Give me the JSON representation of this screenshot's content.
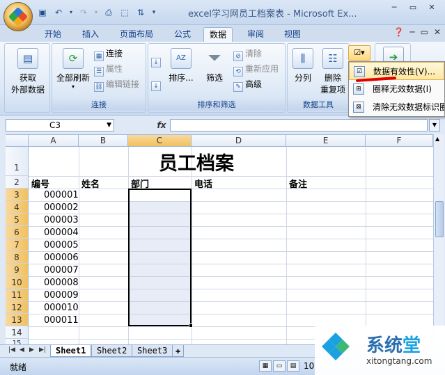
{
  "app": {
    "title": "excel学习网员工档案表 - Microsoft Ex...",
    "window_buttons": [
      "─",
      "▭",
      "✕"
    ]
  },
  "qat": {
    "save_icon": "save-icon",
    "undo_icon": "undo-icon",
    "redo_icon": "redo-icon"
  },
  "tabs": [
    {
      "label": "开始"
    },
    {
      "label": "插入"
    },
    {
      "label": "页面布局"
    },
    {
      "label": "公式"
    },
    {
      "label": "数据",
      "active": true
    },
    {
      "label": "审阅"
    },
    {
      "label": "视图"
    }
  ],
  "ribbon": {
    "groups": {
      "external": {
        "button": "获取\n外部数据",
        "line1": "获取",
        "line2": "外部数据"
      },
      "connections": {
        "label": "连接",
        "refresh_all": "全部刷新",
        "connections": "连接",
        "properties": "属性",
        "edit_links": "编辑链接"
      },
      "sort_filter": {
        "label": "排序和筛选",
        "sort": "排序...",
        "filter": "筛选",
        "clear": "清除",
        "reapply": "重新应用",
        "advanced": "高级"
      },
      "data_tools": {
        "label": "数据工具",
        "text_to_columns": "分列",
        "remove_dup_1": "删除",
        "remove_dup_2": "重复项"
      }
    }
  },
  "menu": {
    "items": [
      {
        "label": "数据有效性(V)...",
        "highlighted": true
      },
      {
        "label": "圈释无效数据(I)"
      },
      {
        "label": "清除无效数据标识圈"
      }
    ]
  },
  "formula_bar": {
    "name_box": "C3",
    "fx": "fx",
    "formula": ""
  },
  "sheet": {
    "columns": [
      "A",
      "B",
      "C",
      "D",
      "E",
      "F"
    ],
    "rows": [
      "1",
      "2",
      "3",
      "4",
      "5",
      "6",
      "7",
      "8",
      "9",
      "10",
      "11",
      "12",
      "13",
      "14",
      "15"
    ],
    "title": "员工档案",
    "headers": {
      "a": "编号",
      "b": "姓名",
      "c": "部门",
      "d": "电话",
      "e": "备注"
    },
    "ids": [
      "000001",
      "000002",
      "000003",
      "000004",
      "000005",
      "000006",
      "000007",
      "000008",
      "000009",
      "000010",
      "000011"
    ]
  },
  "sheet_tabs": [
    {
      "label": "Sheet1",
      "active": true
    },
    {
      "label": "Sheet2"
    },
    {
      "label": "Sheet3"
    }
  ],
  "status": {
    "ready": "就绪",
    "zoom": "10"
  },
  "watermark": {
    "name_1": "系统",
    "name_2": "堂",
    "url": "xitongtang.com"
  }
}
